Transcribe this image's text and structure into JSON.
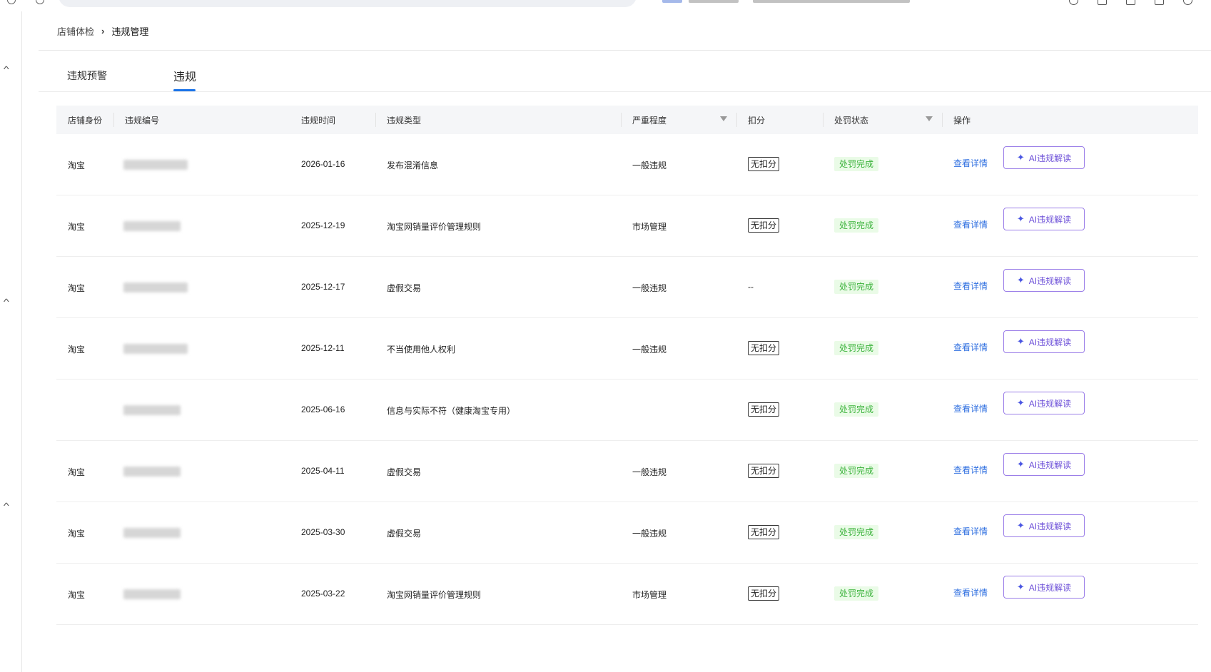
{
  "breadcrumb": {
    "parent": "店铺体检",
    "separator": "›",
    "current": "违规管理"
  },
  "tabs": [
    {
      "label": "违规预警",
      "active": false
    },
    {
      "label": "违规",
      "active": true
    }
  ],
  "table": {
    "headers": {
      "identity": "店铺身份",
      "code": "违规编号",
      "time": "违规时间",
      "type": "违规类型",
      "severity": "严重程度",
      "deduction": "扣分",
      "status": "处罚状态",
      "action": "操作"
    },
    "rows": [
      {
        "identity": "淘宝",
        "time": "2026-01-16",
        "type": "发布混淆信息",
        "severity": "一般违规",
        "deduction": "无扣分",
        "status": "处罚完成",
        "detail": "查看详情",
        "ai": "AI违规解读"
      },
      {
        "identity": "淘宝",
        "time": "2025-12-19",
        "type": "淘宝网销量评价管理规则",
        "severity": "市场管理",
        "deduction": "无扣分",
        "status": "处罚完成",
        "detail": "查看详情",
        "ai": "AI违规解读"
      },
      {
        "identity": "淘宝",
        "time": "2025-12-17",
        "type": "虚假交易",
        "severity": "一般违规",
        "deduction": "--",
        "status": "处罚完成",
        "detail": "查看详情",
        "ai": "AI违规解读"
      },
      {
        "identity": "淘宝",
        "time": "2025-12-11",
        "type": "不当使用他人权利",
        "severity": "一般违规",
        "deduction": "无扣分",
        "status": "处罚完成",
        "detail": "查看详情",
        "ai": "AI违规解读"
      },
      {
        "identity": "",
        "time": "2025-06-16",
        "type": "信息与实际不符（健康淘宝专用）",
        "severity": "",
        "deduction": "无扣分",
        "status": "处罚完成",
        "detail": "查看详情",
        "ai": "AI违规解读"
      },
      {
        "identity": "淘宝",
        "time": "2025-04-11",
        "type": "虚假交易",
        "severity": "一般违规",
        "deduction": "无扣分",
        "status": "处罚完成",
        "detail": "查看详情",
        "ai": "AI违规解读"
      },
      {
        "identity": "淘宝",
        "time": "2025-03-30",
        "type": "虚假交易",
        "severity": "一般违规",
        "deduction": "无扣分",
        "status": "处罚完成",
        "detail": "查看详情",
        "ai": "AI违规解读"
      },
      {
        "identity": "淘宝",
        "time": "2025-03-22",
        "type": "淘宝网销量评价管理规则",
        "severity": "市场管理",
        "deduction": "无扣分",
        "status": "处罚完成",
        "detail": "查看详情",
        "ai": "AI违规解读"
      }
    ]
  },
  "icons": {
    "filter": "filter-icon",
    "sparkle": "sparkle-icon",
    "chevron": "chevron-up-icon"
  },
  "colors": {
    "accent": "#1a73e8",
    "link": "#2f6fe0",
    "status_text": "#3cb33c",
    "status_bg": "#eafbe7",
    "ai_border": "#9b7ee8"
  }
}
